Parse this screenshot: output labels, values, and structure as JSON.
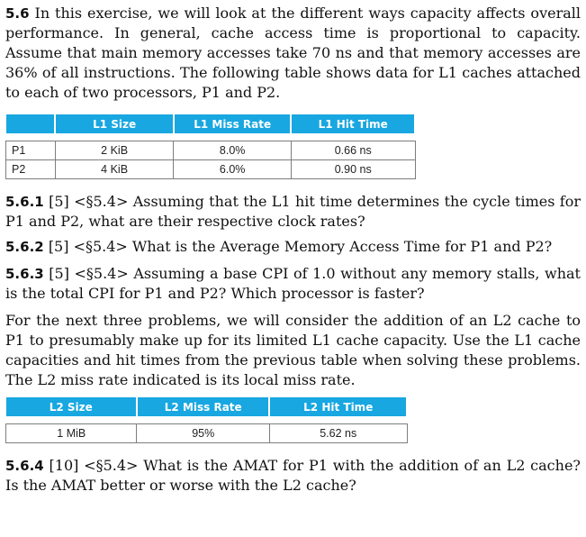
{
  "intro": {
    "number": "5.6",
    "text": "In this exercise, we will look at the different ways capacity affects overall performance. In general, cache access time is proportional to capacity. Assume that main memory accesses take 70 ns and that memory accesses are 36% of all instructions. The following table shows data for L1 caches attached to each of two processors, P1 and P2."
  },
  "table1": {
    "headers": [
      "",
      "L1 Size",
      "L1 Miss Rate",
      "L1 Hit Time"
    ],
    "rows": [
      [
        "P1",
        "2 KiB",
        "8.0%",
        "0.66 ns"
      ],
      [
        "P2",
        "4 KiB",
        "6.0%",
        "0.90 ns"
      ]
    ]
  },
  "questions": [
    {
      "number": "5.6.1",
      "text": "[5] <§5.4> Assuming that the L1 hit time determines the cycle times for P1 and P2, what are their respective clock rates?"
    },
    {
      "number": "5.6.2",
      "text": "[5] <§5.4> What is the Average Memory Access Time for P1 and P2?"
    },
    {
      "number": "5.6.3",
      "text": "[5] <§5.4> Assuming a base CPI of 1.0 without any memory stalls, what is the total CPI for P1 and P2? Which processor is faster?"
    }
  ],
  "middle_paragraph": "For the next three problems, we will consider the addition of an L2 cache to P1 to presumably make up for its limited L1 cache capacity. Use the L1 cache capacities and hit times from the previous table when solving these problems. The L2 miss rate indicated is its local miss rate.",
  "table2": {
    "headers": [
      "L2 Size",
      "L2 Miss Rate",
      "L2 Hit Time"
    ],
    "rows": [
      [
        "1 MiB",
        "95%",
        "5.62 ns"
      ]
    ]
  },
  "question4": {
    "number": "5.6.4",
    "text": "[10] <§5.4> What is the AMAT for P1 with the addition of an L2 cache? Is the AMAT better or worse with the L2 cache?"
  },
  "colors": {
    "header_bg": "#18a7e0",
    "header_text": "#ffffff",
    "cell_border": "#7d7d7d"
  }
}
